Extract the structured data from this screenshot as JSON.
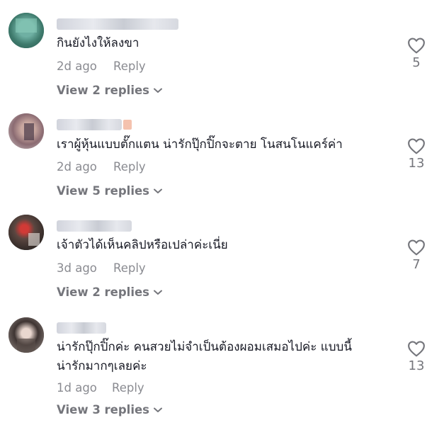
{
  "comments": [
    {
      "text": "กินยังไงให้ลงขา",
      "date": "2d ago",
      "reply_label": "Reply",
      "view_replies": "View 2 replies",
      "likes": "5"
    },
    {
      "text": "เราผู้หุ้นแบบตั๊กแตน น่ารักปุ๊กปิ๊กจะตาย โนสนโนแคร์ค่า",
      "date": "2d ago",
      "reply_label": "Reply",
      "view_replies": "View 5 replies",
      "likes": "13"
    },
    {
      "text": "เจ้าตัวได้เห็นคลิปหรือเปล่าค่ะเนี่ย",
      "date": "3d ago",
      "reply_label": "Reply",
      "view_replies": "View 2 replies",
      "likes": "7"
    },
    {
      "text_line1": "น่ารักปุ๊กปิ๊กค่ะ คนสวยไม่จำเป็นต้องผอมเสมอไปค่ะ แบบนี้",
      "text_line2": "น่ารักมากๆเลยค่ะ",
      "date": "1d ago",
      "reply_label": "Reply",
      "view_replies": "View 3 replies",
      "likes": "13"
    }
  ],
  "icons": {
    "like": "heart-outline-icon",
    "expand": "chevron-down-icon"
  },
  "colors": {
    "text": "#161823",
    "meta": "#8a8b91",
    "view_replies": "#75767c"
  }
}
